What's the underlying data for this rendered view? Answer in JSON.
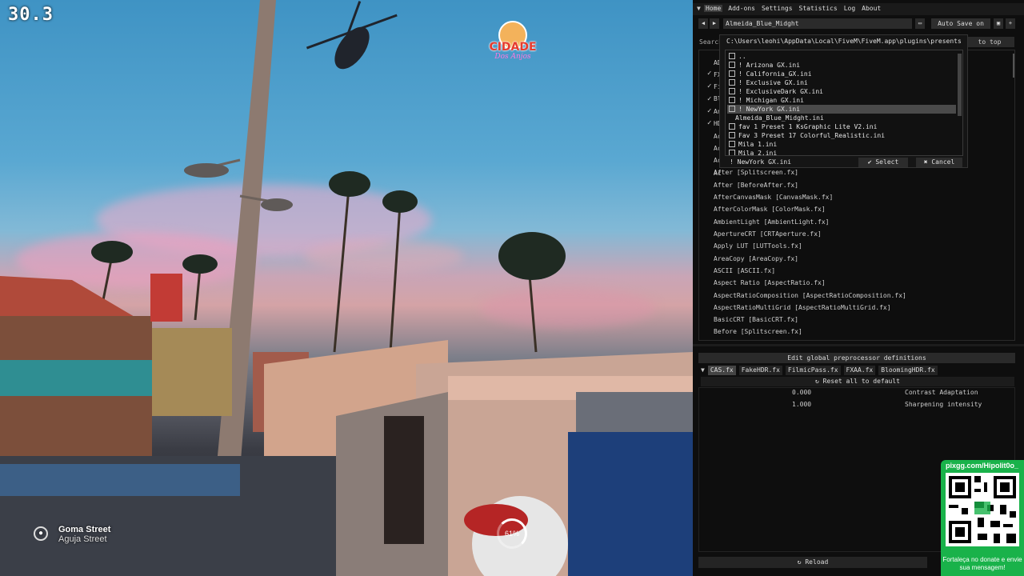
{
  "hud": {
    "fps": "30.3",
    "logo_name": "CIDADE",
    "logo_sub": "Dos Anjos",
    "street_primary": "Goma Street",
    "street_secondary": "Aguja Street",
    "progress": "61%"
  },
  "menubar": {
    "arrow": "▼",
    "items": [
      "Home",
      "Add-ons",
      "Settings",
      "Statistics",
      "Log",
      "About"
    ]
  },
  "toolbar": {
    "prev": "◀",
    "next": "▶",
    "preset": "Almeida_Blue_Midght",
    "autosave": "Auto Save on"
  },
  "search": {
    "label": "Search",
    "to_top": "to top"
  },
  "checks": [
    "✓",
    "✓",
    "✓",
    "✓",
    "✓"
  ],
  "effects_hidden": [
    "AD",
    "FX",
    "Fi",
    "Bl",
    "An",
    "HD",
    "Ac",
    "Ac",
    "Ac",
    "Ac"
  ],
  "effects": [
    "After [Splitscreen.fx]",
    "After [BeforeAfter.fx]",
    "AfterCanvasMask [CanvasMask.fx]",
    "AfterColorMask [ColorMask.fx]",
    "AmbientLight [AmbientLight.fx]",
    "ApertureCRT [CRTAperture.fx]",
    "Apply LUT [LUTTools.fx]",
    "AreaCopy [AreaCopy.fx]",
    "ASCII [ASCII.fx]",
    "Aspect Ratio [AspectRatio.fx]",
    "AspectRatioComposition [AspectRatioComposition.fx]",
    "AspectRatioMultiGrid [AspectRatioMultiGrid.fx]",
    "BasicCRT [BasicCRT.fx]",
    "Before [Splitscreen.fx]"
  ],
  "dialog": {
    "path": "C:\\Users\\leohi\\AppData\\Local\\FiveM\\FiveM.app\\plugins\\presentss",
    "files": [
      {
        "name": "..",
        "icon": true
      },
      {
        "name": "! Arizona GX.ini",
        "icon": true
      },
      {
        "name": "! California_GX.ini",
        "icon": true
      },
      {
        "name": "! Exclusive GX.ini",
        "icon": true
      },
      {
        "name": "! ExclusiveDark GX.ini",
        "icon": true
      },
      {
        "name": "! Michigan GX.ini",
        "icon": true
      },
      {
        "name": "! NewYork  GX.ini",
        "icon": true
      },
      {
        "name": "Almeida_Blue_Midght.ini",
        "icon": false
      },
      {
        "name": "fav 1 Preset 1 KsGraphic Lite V2.ini",
        "icon": true
      },
      {
        "name": "Fav 3 Preset 17 Colorful_Realistic.ini",
        "icon": true
      },
      {
        "name": "Mila 1.ini",
        "icon": true
      },
      {
        "name": "Mila 2.ini",
        "icon": true
      }
    ],
    "selected_index": 6,
    "current": "! NewYork  GX.ini",
    "select": "✔ Select",
    "cancel": "✖ Cancel"
  },
  "preprocessor": {
    "edit": "Edit global preprocessor definitions",
    "tabs": [
      "CAS.fx",
      "FakeHDR.fx",
      "FilmicPass.fx",
      "FXAA.fx",
      "BloomingHDR.fx"
    ],
    "active_tab": 0,
    "reset": "↻ Reset all to default",
    "params": [
      {
        "value": "0.000",
        "name": "Contrast Adaptation"
      },
      {
        "value": "1.000",
        "name": "Sharpening intensity"
      }
    ]
  },
  "reload": "↻ Reload",
  "qr": {
    "handle": "pixgg.com/Hipolit0o_",
    "message": "Fortaleça no donate e envie sua mensagem!"
  },
  "colors": {
    "qr_green": "#19b24a",
    "overlay_bg": "#0e0e0e",
    "selection": "#4a4a4a"
  }
}
